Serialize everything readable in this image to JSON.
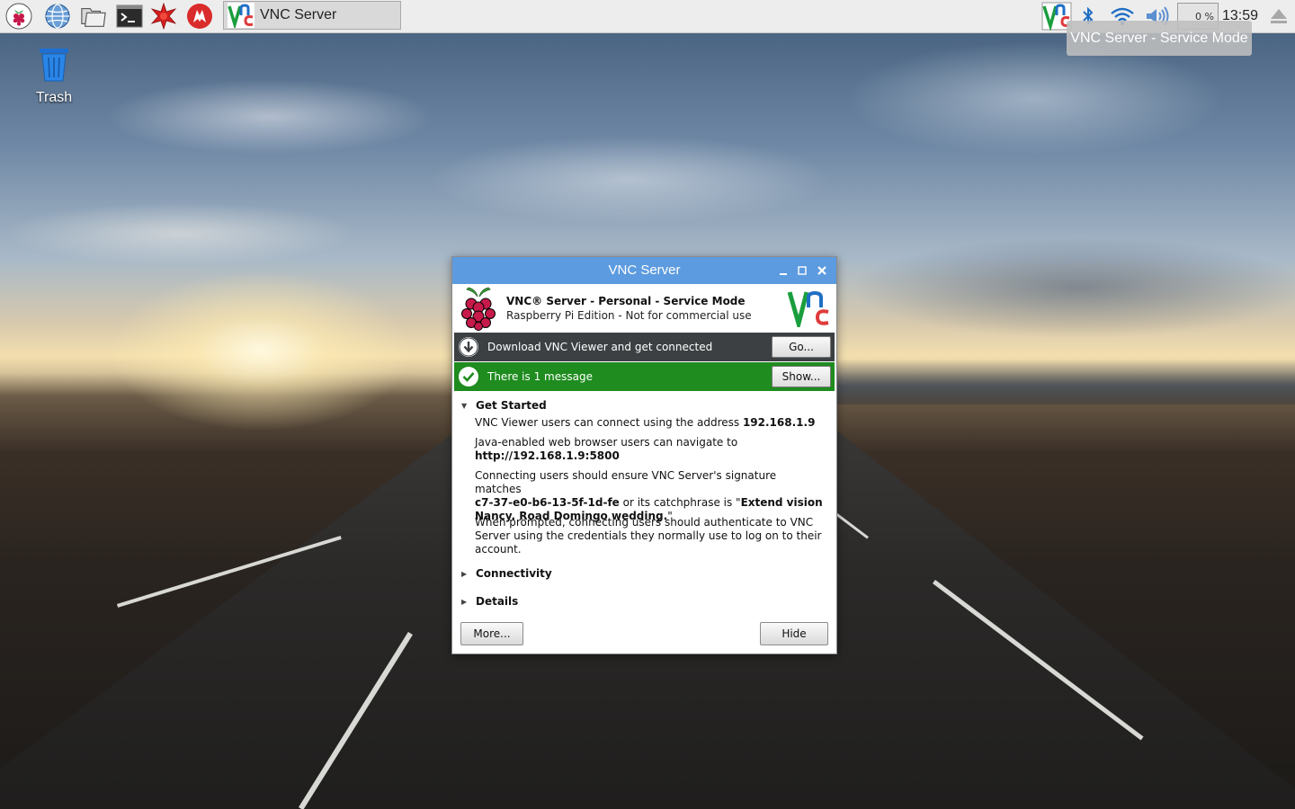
{
  "desktop": {
    "icons": [
      {
        "label": "Trash",
        "icon": "trash-icon"
      }
    ]
  },
  "taskbar": {
    "launchers": [
      {
        "icon": "raspberry-menu-icon"
      },
      {
        "icon": "web-browser-icon"
      },
      {
        "icon": "file-manager-icon"
      },
      {
        "icon": "terminal-icon"
      },
      {
        "icon": "mathematica-icon"
      },
      {
        "icon": "wolfram-icon"
      }
    ],
    "task": {
      "label": "VNC Server",
      "icon": "vnc-logo-icon"
    },
    "tray": {
      "cpu_value": "0",
      "cpu_unit": "%",
      "clock": "13:59",
      "tooltip": "VNC Server - Service Mode"
    }
  },
  "window": {
    "title": "VNC Server",
    "header_title": "VNC® Server - Personal - Service Mode",
    "header_subtitle": "Raspberry Pi Edition - Not for commercial use",
    "download_bar": {
      "text": "Download VNC Viewer and get connected",
      "button": "Go..."
    },
    "message_bar": {
      "text": "There is 1 message",
      "button": "Show..."
    },
    "get_started": {
      "label": "Get Started",
      "p1_text": "VNC Viewer users can connect using the address ",
      "p1_address": "192.168.1.9",
      "p2_text": "Java-enabled web browser users can navigate to",
      "p2_url": "http://192.168.1.9:5800",
      "p3_text1": "Connecting users should ensure VNC Server's signature matches",
      "p3_signature": "c7-37-e0-b6-13-5f-1d-fe",
      "p3_text2": " or its catchphrase is \"",
      "p3_catchphrase_1": "Extend vision",
      "p3_catchphrase_2": "Nancy. Road Domingo wedding.",
      "p3_text3": "\"",
      "p4_text": "When prompted, connecting users should authenticate to VNC Server using the credentials they normally use to log on to their account."
    },
    "connectivity_label": "Connectivity",
    "details_label": "Details",
    "more_button": "More...",
    "hide_button": "Hide"
  },
  "colors": {
    "titlebar": "#5d9be0",
    "download_bar": "#3c4043",
    "message_bar": "#1e8c1e",
    "vnc_green": "#1b9e3e",
    "vnc_blue": "#1f6fc4",
    "vnc_red": "#e03a3a"
  }
}
